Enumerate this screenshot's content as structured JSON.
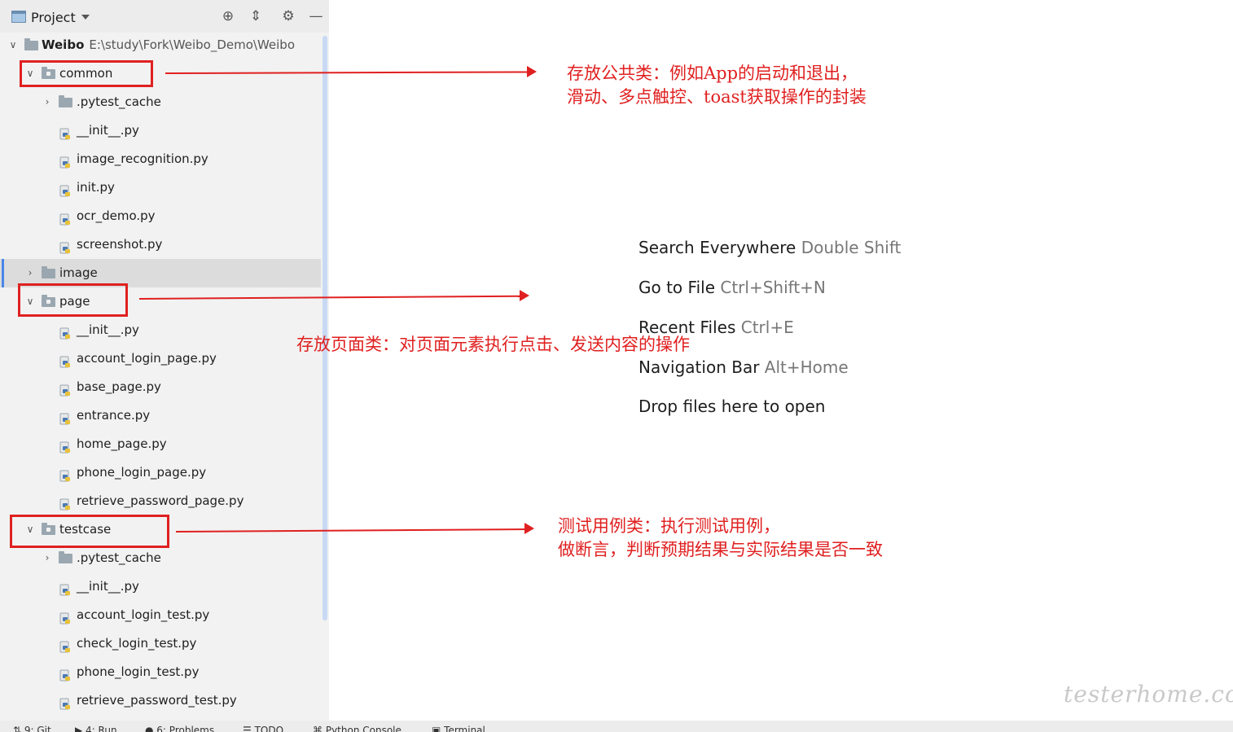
{
  "toolbar": {
    "title": "Project"
  },
  "tree": {
    "root": {
      "name": "Weibo",
      "path": "E:\\study\\Fork\\Weibo_Demo\\Weibo"
    },
    "common": {
      "name": "common",
      "pytest_cache": ".pytest_cache",
      "files": [
        "__init__.py",
        "image_recognition.py",
        "init.py",
        "ocr_demo.py",
        "screenshot.py"
      ]
    },
    "image": {
      "name": "image"
    },
    "page": {
      "name": "page",
      "files": [
        "__init__.py",
        "account_login_page.py",
        "base_page.py",
        "entrance.py",
        "home_page.py",
        "phone_login_page.py",
        "retrieve_password_page.py"
      ]
    },
    "testcase": {
      "name": "testcase",
      "pytest_cache": ".pytest_cache",
      "files": [
        "__init__.py",
        "account_login_test.py",
        "check_login_test.py",
        "phone_login_test.py",
        "retrieve_password_test.py"
      ]
    }
  },
  "annotations": {
    "common": [
      "存放公共类：例如App的启动和退出，",
      "滑动、多点触控、toast获取操作的封装"
    ],
    "page": [
      "存放页面类：对页面元素执行点击、发送内容的操作"
    ],
    "testcase": [
      "测试用例类：执行测试用例，",
      "做断言，判断预期结果与实际结果是否一致"
    ]
  },
  "hints": [
    {
      "action": "Search Everywhere",
      "key": "Double Shift"
    },
    {
      "action": "Go to File",
      "key": "Ctrl+Shift+N"
    },
    {
      "action": "Recent Files",
      "key": "Ctrl+E"
    },
    {
      "action": "Navigation Bar",
      "key": "Alt+Home"
    },
    {
      "action": "Drop files here to open",
      "key": ""
    }
  ],
  "bottom_tabs": [
    "9: Git",
    "4: Run",
    "6: Problems",
    "TODO",
    "Python Console",
    "Terminal"
  ],
  "watermark": "testerhome.com",
  "colors": {
    "annotation": "#e02020",
    "selection": "#4a86e8"
  }
}
